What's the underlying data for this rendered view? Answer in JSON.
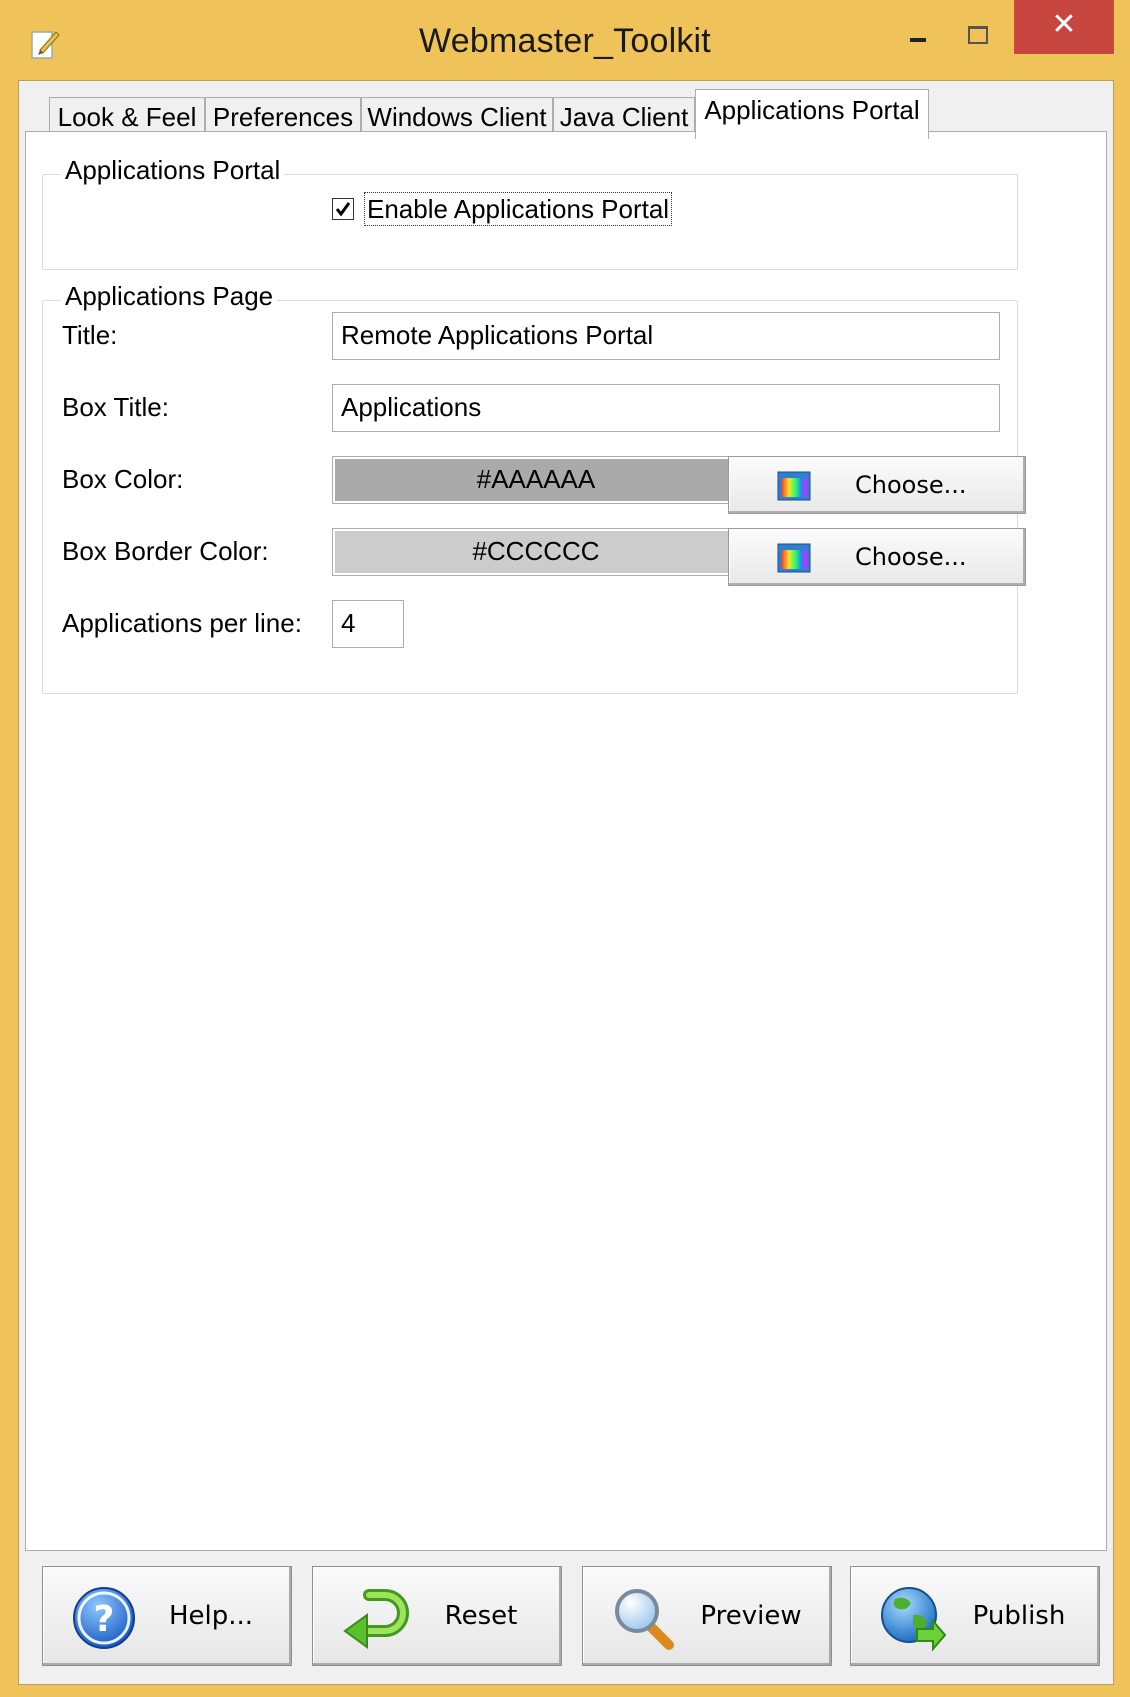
{
  "window": {
    "title": "Webmaster_Toolkit",
    "close_glyph": "✕"
  },
  "tabs": [
    {
      "label": "Look & Feel"
    },
    {
      "label": "Preferences"
    },
    {
      "label": "Windows Client"
    },
    {
      "label": "Java Client"
    },
    {
      "label": "Applications Portal",
      "active": true
    }
  ],
  "portal_group": {
    "legend": "Applications Portal",
    "enable_checkbox": {
      "label": "Enable Applications Portal",
      "checked": true
    }
  },
  "page_group": {
    "legend": "Applications Page",
    "title_label": "Title:",
    "title_value": "Remote Applications Portal",
    "box_title_label": "Box Title:",
    "box_title_value": "Applications",
    "box_color_label": "Box Color:",
    "box_color_value": "#AAAAAA",
    "box_border_color_label": "Box Border Color:",
    "box_border_color_value": "#CCCCCC",
    "choose_label": "Choose...",
    "apps_per_line_label": "Applications per line:",
    "apps_per_line_value": "4"
  },
  "buttons": {
    "help": "Help...",
    "reset": "Reset",
    "preview": "Preview",
    "publish": "Publish"
  },
  "colors": {
    "window_frame": "#f0c35a",
    "close_button": "#c7463f",
    "box_color": "#AAAAAA",
    "box_border_color": "#CCCCCC"
  }
}
